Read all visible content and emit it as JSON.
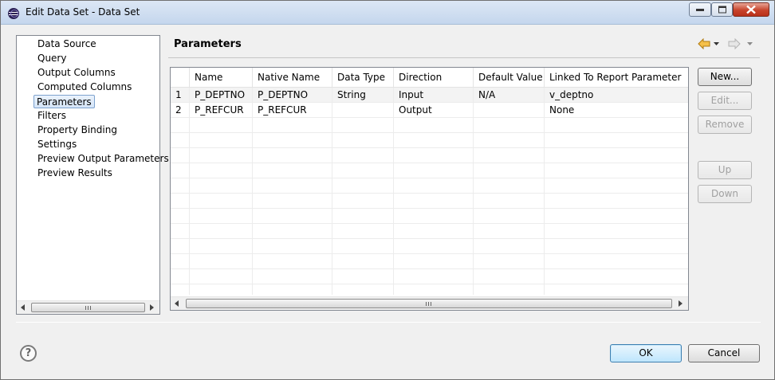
{
  "window": {
    "title": "Edit Data Set - Data Set"
  },
  "nav": {
    "items": [
      {
        "label": "Data Source"
      },
      {
        "label": "Query"
      },
      {
        "label": "Output Columns"
      },
      {
        "label": "Computed Columns"
      },
      {
        "label": "Parameters",
        "selected": true
      },
      {
        "label": "Filters"
      },
      {
        "label": "Property Binding"
      },
      {
        "label": "Settings"
      },
      {
        "label": "Preview Output Parameters"
      },
      {
        "label": "Preview Results"
      }
    ]
  },
  "page": {
    "title": "Parameters"
  },
  "table": {
    "columns": [
      "",
      "Name",
      "Native Name",
      "Data Type",
      "Direction",
      "Default Value",
      "Linked To Report Parameter"
    ],
    "rows": [
      [
        "1",
        "P_DEPTNO",
        "P_DEPTNO",
        "String",
        "Input",
        "N/A",
        "v_deptno"
      ],
      [
        "2",
        "P_REFCUR",
        "P_REFCUR",
        "",
        "Output",
        "",
        "None"
      ]
    ]
  },
  "buttons": {
    "new": "New...",
    "edit": "Edit...",
    "remove": "Remove",
    "up": "Up",
    "down": "Down",
    "ok": "OK",
    "cancel": "Cancel"
  },
  "help": {
    "glyph": "?"
  },
  "scrollbar_grip": "III",
  "colors": {
    "accent": "#3c7fb1",
    "selection": "#d5e5f8",
    "back_arrow": "#e8a317"
  }
}
